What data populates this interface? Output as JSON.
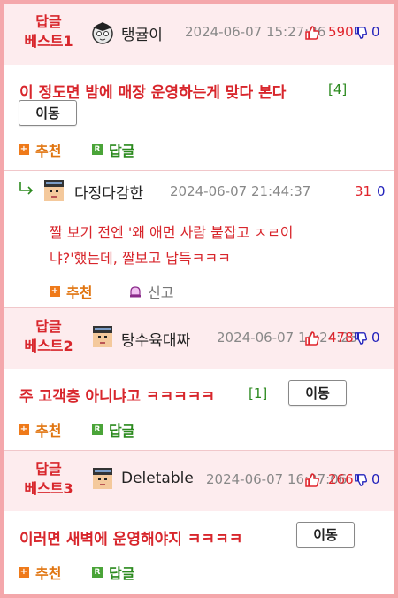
{
  "posts": [
    {
      "best_label_line1": "답글",
      "best_label_line2": "베스트1",
      "nick": "탱귤이",
      "datetime": "2024-06-07 15:27:36",
      "up": "590",
      "down": "0",
      "title": "이 정도면 밤에 매장 운영하는게 맞다 본다",
      "comment_count": "[4]",
      "move_label": "이동",
      "recommend_label": "추천",
      "reply_label": "답글"
    },
    {
      "best_label_line1": "답글",
      "best_label_line2": "베스트2",
      "nick": "탕수육대짜",
      "datetime": "2024-06-07 14:24:23",
      "up": "478",
      "down": "0",
      "title": "주 고객층 아니냐고 ㅋㅋㅋㅋㅋ",
      "comment_count": "[1]",
      "move_label": "이동",
      "recommend_label": "추천",
      "reply_label": "답글"
    },
    {
      "best_label_line1": "답글",
      "best_label_line2": "베스트3",
      "nick": "Deletable",
      "datetime": "2024-06-07 16:27:06",
      "up": "266",
      "down": "0",
      "title": "이러면 새벽에 운영해야지 ㅋㅋㅋㅋ",
      "comment_count": "",
      "move_label": "이동",
      "recommend_label": "추천",
      "reply_label": "답글"
    }
  ],
  "reply": {
    "nick": "다정다감한",
    "datetime": "2024-06-07 21:44:37",
    "up": "31",
    "down": "0",
    "text_line1": "짤 보기 전엔 '왜 애먼 사람 붙잡고 ㅈㄹ이",
    "text_line2": "냐?'했는데, 짤보고 납득ㅋㅋㅋ",
    "recommend_label": "추천",
    "report_label": "신고"
  },
  "colors": {
    "accent_red": "#d8262c",
    "best_bg": "#fdecee",
    "border_pink": "#f4a7ab",
    "green": "#2c8a1f",
    "orange": "#e0740f"
  }
}
